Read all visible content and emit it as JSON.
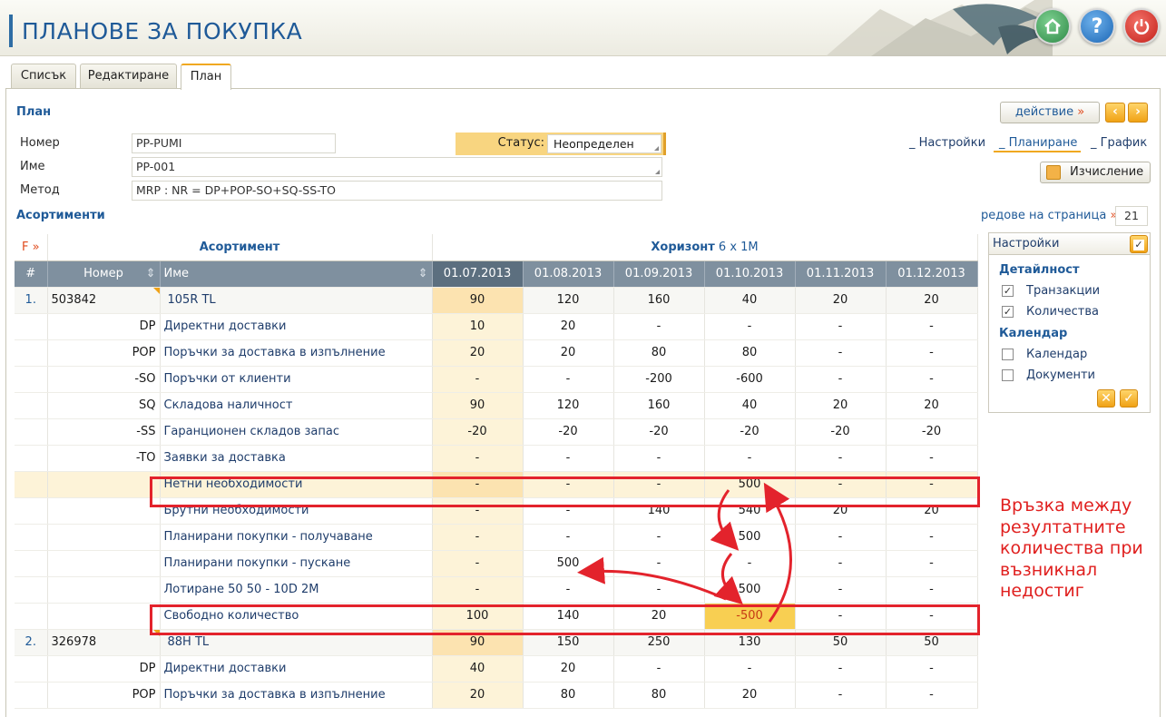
{
  "window": {
    "title": "ПЛАНОВЕ ЗА ПОКУПКА"
  },
  "tabs": [
    "Списък",
    "Редактиране",
    "План"
  ],
  "plan": {
    "section_title": "План",
    "action_button": "действие",
    "action_arrows": "»",
    "fields": [
      {
        "label": "Номер",
        "value": "PP-PUMI"
      },
      {
        "label": "Име",
        "value": "PP-001"
      },
      {
        "label": "Метод",
        "value": "MRP : NR = DP+POP-SO+SQ-SS-TO"
      }
    ],
    "status_label": "Статус:",
    "status_value": "Неопределен",
    "views": [
      "_ Настройки",
      "_ Планиране",
      "_ График"
    ],
    "calc_button": "Изчисление"
  },
  "assortments": {
    "title": "Асортименти",
    "rows_per_page_label": "редове на страница",
    "rows_per_page_arrows": "»",
    "rows_per_page": "21",
    "filter_label": "F »",
    "group_header": "Асортимент",
    "horizon_label": "Хоризонт",
    "horizon_value": "6 x 1M",
    "columns": [
      "#",
      "Номер",
      "Име",
      "01.07.2013",
      "01.08.2013",
      "01.09.2013",
      "01.10.2013",
      "01.11.2013",
      "01.12.2013"
    ],
    "rows": [
      {
        "idx": "1.",
        "number": "503842",
        "code": "",
        "name": "105R TL",
        "values": [
          "90",
          "120",
          "160",
          "40",
          "20",
          "20"
        ]
      },
      {
        "idx": "",
        "number": "",
        "code": "DP",
        "name": "Директни доставки",
        "values": [
          "10",
          "20",
          "-",
          "-",
          "-",
          "-"
        ]
      },
      {
        "idx": "",
        "number": "",
        "code": "POP",
        "name": "Поръчки за доставка в изпълнение",
        "values": [
          "20",
          "20",
          "80",
          "80",
          "-",
          "-"
        ]
      },
      {
        "idx": "",
        "number": "",
        "code": "-SO",
        "name": "Поръчки от клиенти",
        "values": [
          "-",
          "-",
          "-200",
          "-600",
          "-",
          "-"
        ]
      },
      {
        "idx": "",
        "number": "",
        "code": "SQ",
        "name": "Складова наличност",
        "values": [
          "90",
          "120",
          "160",
          "40",
          "20",
          "20"
        ]
      },
      {
        "idx": "",
        "number": "",
        "code": "-SS",
        "name": "Гаранционен складов запас",
        "values": [
          "-20",
          "-20",
          "-20",
          "-20",
          "-20",
          "-20"
        ]
      },
      {
        "idx": "",
        "number": "",
        "code": "-TO",
        "name": "Заявки за доставка",
        "values": [
          "-",
          "-",
          "-",
          "-",
          "-",
          "-"
        ]
      },
      {
        "idx": "",
        "number": "",
        "code": "",
        "name": "Нетни необходимости",
        "values": [
          "-",
          "-",
          "-",
          "500",
          "-",
          "-"
        ]
      },
      {
        "idx": "",
        "number": "",
        "code": "",
        "name": "Брутни необходимости",
        "values": [
          "-",
          "-",
          "140",
          "540",
          "20",
          "20"
        ]
      },
      {
        "idx": "",
        "number": "",
        "code": "",
        "name": "Планирани покупки - получаване",
        "values": [
          "-",
          "-",
          "-",
          "500",
          "-",
          "-"
        ]
      },
      {
        "idx": "",
        "number": "",
        "code": "",
        "name": "Планирани покупки - пускане",
        "values": [
          "-",
          "500",
          "-",
          "-",
          "-",
          "-"
        ]
      },
      {
        "idx": "",
        "number": "",
        "code": "",
        "name": "Лотиране 50 50 - 10D 2M",
        "values": [
          "-",
          "-",
          "-",
          "500",
          "-",
          "-"
        ]
      },
      {
        "idx": "",
        "number": "",
        "code": "",
        "name": "Свободно количество",
        "values": [
          "100",
          "140",
          "20",
          "-500",
          "-",
          "-"
        ]
      },
      {
        "idx": "2.",
        "number": "326978",
        "code": "",
        "name": "88H TL",
        "values": [
          "90",
          "150",
          "250",
          "130",
          "50",
          "50"
        ]
      },
      {
        "idx": "",
        "number": "",
        "code": "DP",
        "name": "Директни доставки",
        "values": [
          "40",
          "20",
          "-",
          "-",
          "-",
          "-"
        ]
      },
      {
        "idx": "",
        "number": "",
        "code": "POP",
        "name": "Поръчки за доставка в изпълнение",
        "values": [
          "20",
          "80",
          "80",
          "20",
          "-",
          "-"
        ]
      }
    ]
  },
  "settings_panel": {
    "title": "Настройки",
    "detail_header": "Детайлност",
    "detail_items": [
      {
        "label": "Транзакции",
        "checked": true
      },
      {
        "label": "Количества",
        "checked": true
      }
    ],
    "calendar_header": "Календар",
    "calendar_items": [
      {
        "label": "Календар",
        "checked": false
      },
      {
        "label": "Документи",
        "checked": false
      }
    ]
  },
  "annotation": {
    "lines": [
      "Връзка между",
      "резултатните",
      "количества при",
      "възникнал",
      "недостиг"
    ]
  },
  "colors": {
    "accent": "#1f5a98",
    "highlight": "#fce3b0",
    "warning": "#e3232c",
    "orange": "#f0a216"
  }
}
